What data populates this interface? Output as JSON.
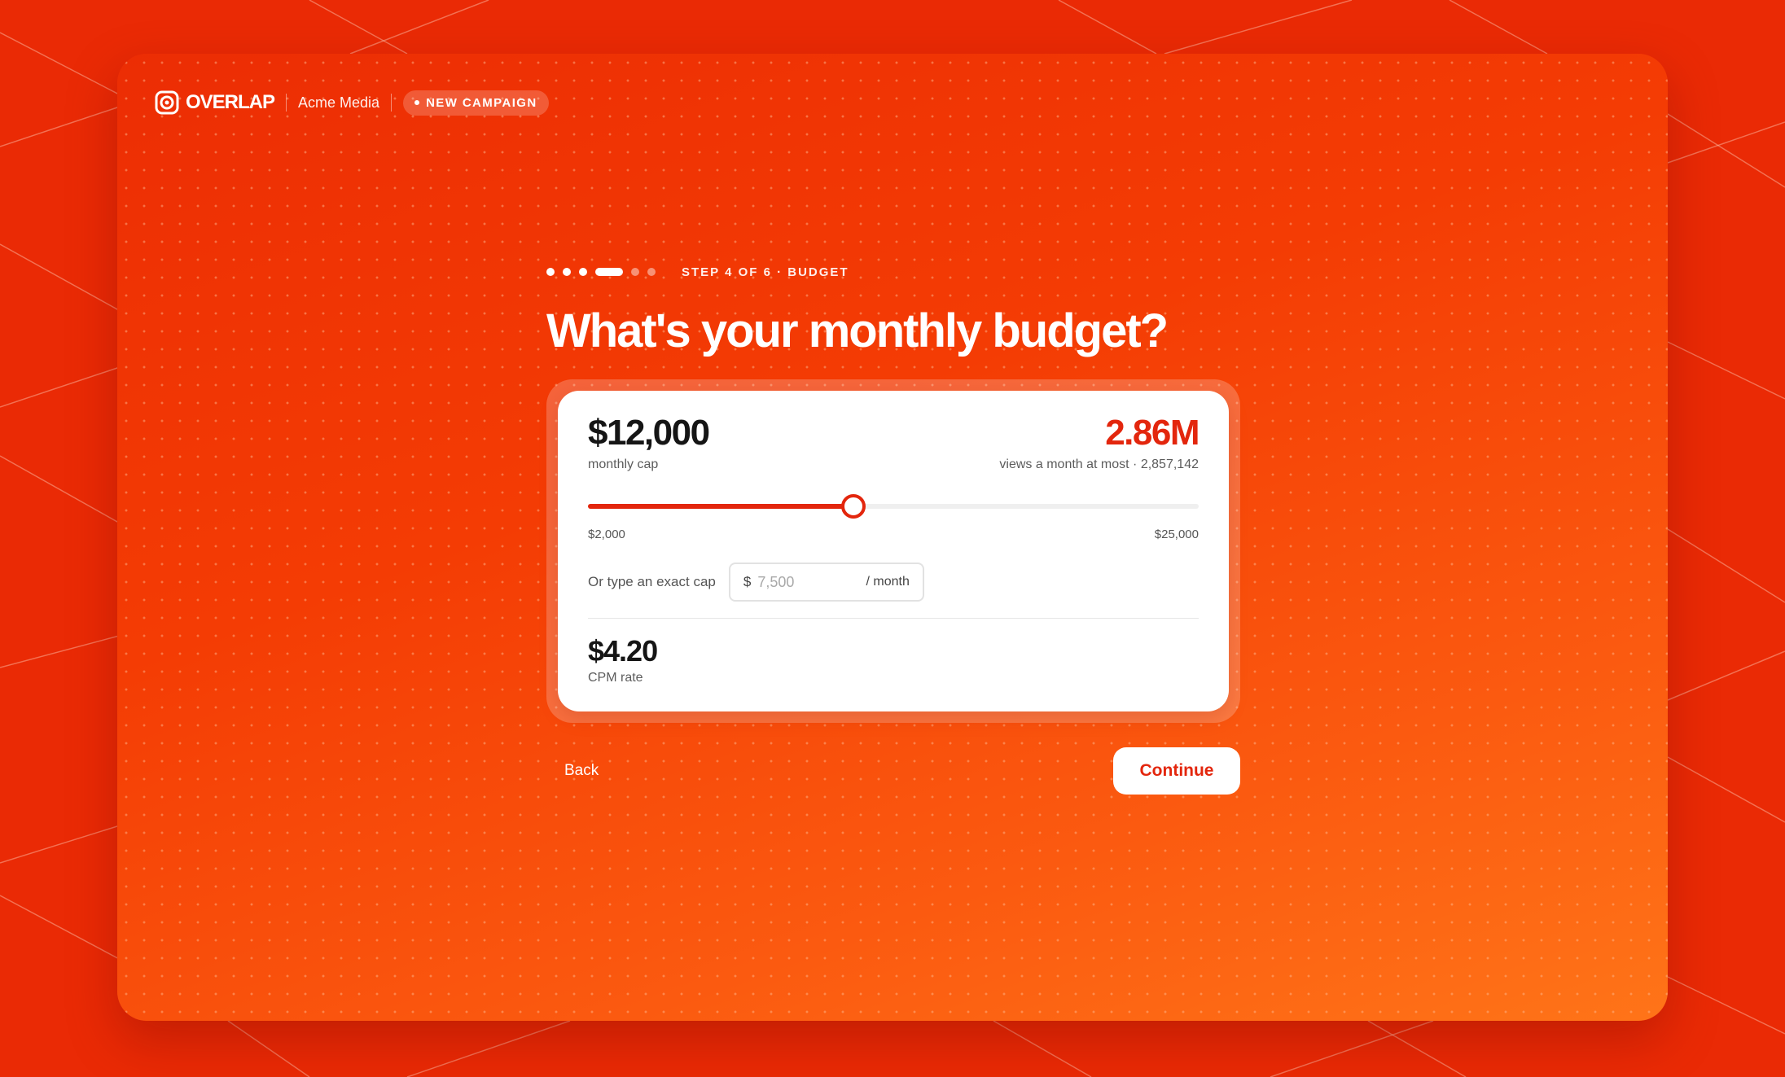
{
  "header": {
    "brand": "OVERLAP",
    "organization": "Acme Media",
    "badge": "NEW CAMPAIGN"
  },
  "progress": {
    "current_step": 4,
    "total_steps": 6,
    "label": "STEP 4 OF 6 · BUDGET"
  },
  "page": {
    "title": "What's your monthly budget?"
  },
  "budget": {
    "amount": "$12,000",
    "amount_label": "monthly cap",
    "views": "2.86M",
    "views_label": "views a month at most · 2,857,142",
    "slider": {
      "min_label": "$2,000",
      "max_label": "$25,000",
      "min": 2000,
      "max": 25000,
      "value": 12000
    },
    "exact_label": "Or type an exact cap",
    "currency_symbol": "$",
    "input_placeholder": "7,500",
    "input_value": "",
    "per_unit": "/ month",
    "cpm": "$4.20",
    "cpm_label": "CPM rate"
  },
  "actions": {
    "back": "Back",
    "continue": "Continue"
  },
  "colors": {
    "accent": "#e3260d",
    "background": "#ea2a05"
  }
}
